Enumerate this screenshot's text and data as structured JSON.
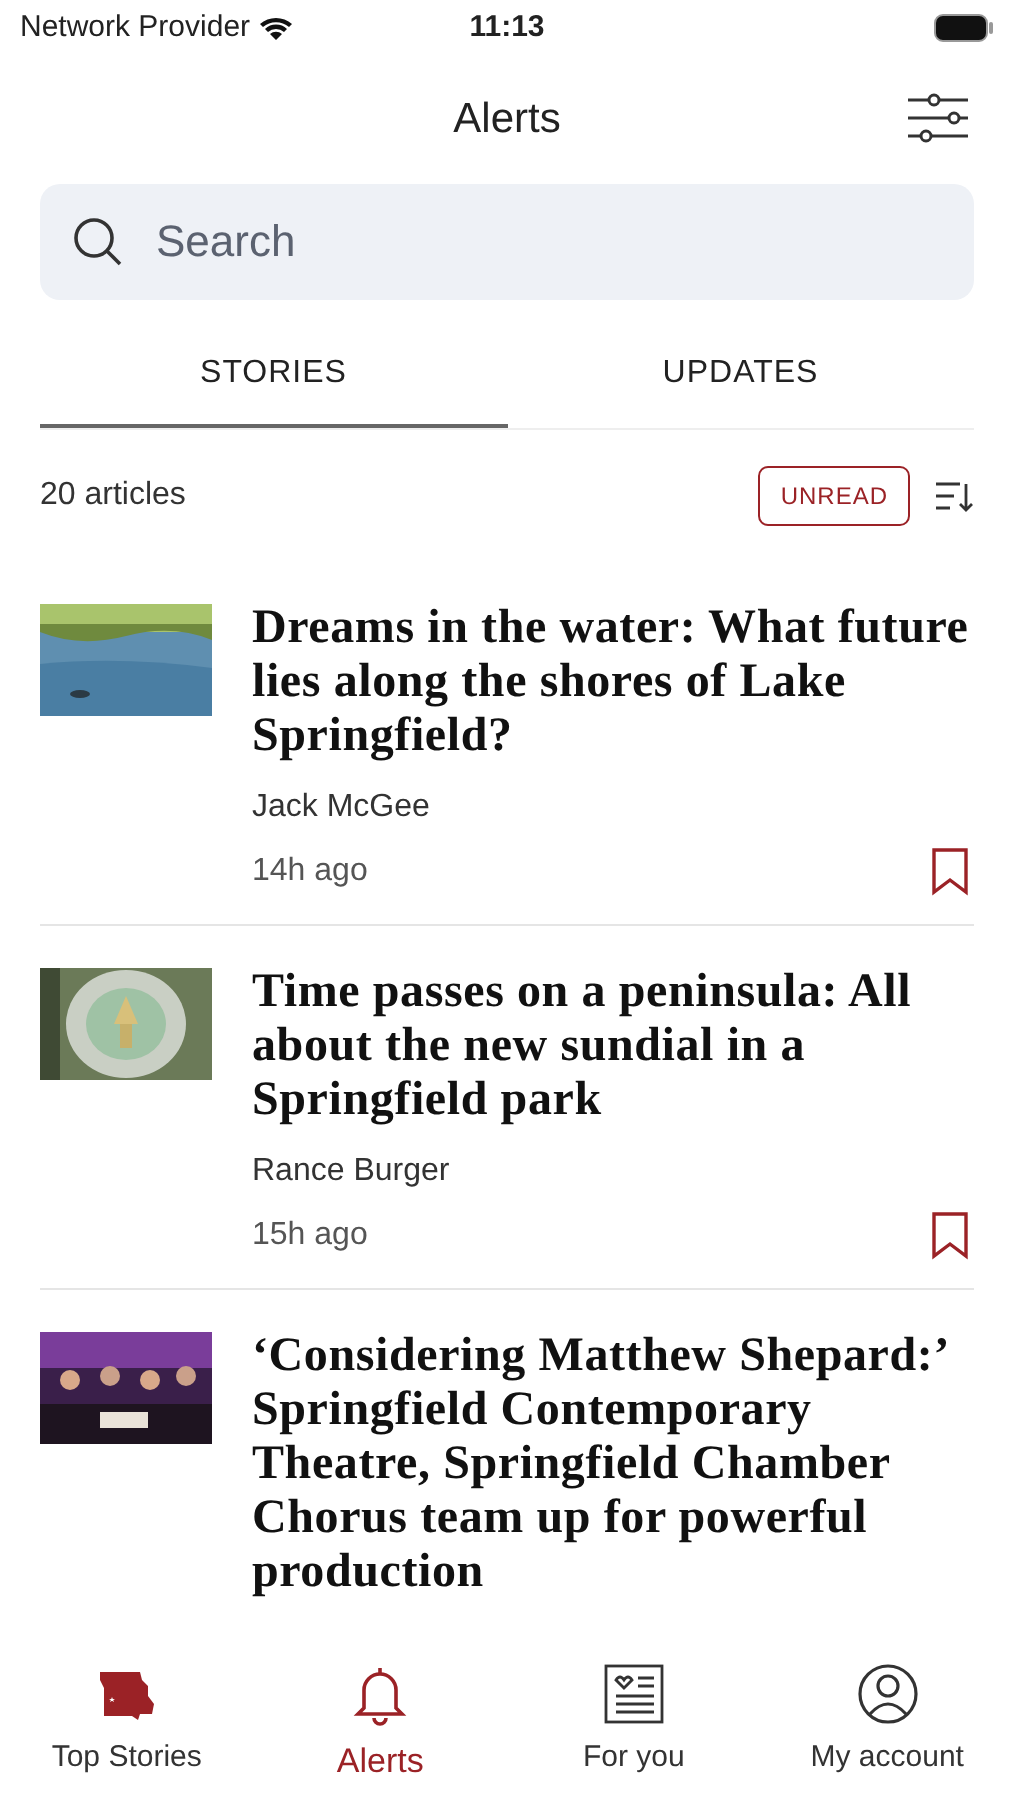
{
  "status_bar": {
    "carrier": "Network Provider",
    "time": "11:13"
  },
  "header": {
    "title": "Alerts"
  },
  "search": {
    "placeholder": "Search"
  },
  "tabs": [
    {
      "label": "STORIES",
      "selected": true
    },
    {
      "label": "UPDATES",
      "selected": false
    }
  ],
  "list_header": {
    "count": "20 articles",
    "filter": "UNREAD"
  },
  "articles": [
    {
      "title": "Dreams in the water: What future lies along the shores of Lake Springfield?",
      "author": "Jack McGee",
      "time": "14h ago",
      "bookmarked": false
    },
    {
      "title": "Time passes on a peninsula: All about the new sundial in a Springfield park",
      "author": "Rance Burger",
      "time": "15h ago",
      "bookmarked": false
    },
    {
      "title": "‘Considering Matthew Shepard:’ Springfield Contemporary Theatre, Springfield Chamber Chorus team up for powerful production"
    }
  ],
  "tab_bar": [
    {
      "label": "Top Stories",
      "selected": false
    },
    {
      "label": "Alerts",
      "selected": true
    },
    {
      "label": "For you",
      "selected": false
    },
    {
      "label": "My account",
      "selected": false
    }
  ]
}
